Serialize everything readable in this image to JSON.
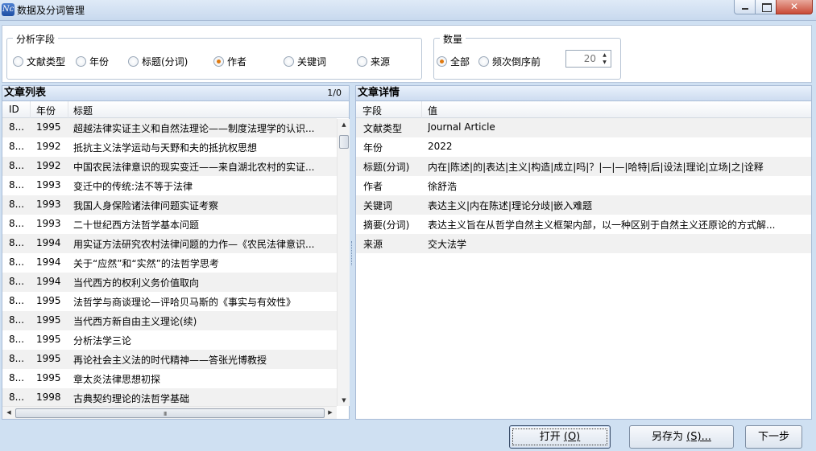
{
  "window": {
    "title": "数据及分词管理",
    "icon_text": "Nc",
    "close_glyph": "✕"
  },
  "field_group": {
    "legend": "分析字段",
    "options": [
      {
        "label": "文献类型",
        "checked": false
      },
      {
        "label": "年份",
        "checked": false
      },
      {
        "label": "标题(分词)",
        "checked": false
      },
      {
        "label": "作者",
        "checked": true
      },
      {
        "label": "关键词",
        "checked": false
      },
      {
        "label": "来源",
        "checked": false
      }
    ]
  },
  "count_group": {
    "legend": "数量",
    "options": [
      {
        "label": "全部",
        "checked": true
      },
      {
        "label": "频次倒序前",
        "checked": false
      }
    ],
    "spin_value": "20"
  },
  "doc_list": {
    "title": "文章列表",
    "count": "1/0",
    "columns": [
      "ID",
      "年份",
      "标题"
    ],
    "rows": [
      {
        "id": "8...",
        "year": "1995",
        "title": "超越法律实证主义和自然法理论——制度法理学的认识..."
      },
      {
        "id": "8...",
        "year": "1992",
        "title": "抵抗主义法学运动与天野和夫的抵抗权思想"
      },
      {
        "id": "8...",
        "year": "1992",
        "title": "中国农民法律意识的现实变迁——来自湖北农村的实证..."
      },
      {
        "id": "8...",
        "year": "1993",
        "title": "变迁中的传统:法不等于法律"
      },
      {
        "id": "8...",
        "year": "1993",
        "title": "我国人身保险诸法律问题实证考察"
      },
      {
        "id": "8...",
        "year": "1993",
        "title": "二十世纪西方法哲学基本问题"
      },
      {
        "id": "8...",
        "year": "1994",
        "title": "用实证方法研究农村法律问题的力作—《农民法律意识..."
      },
      {
        "id": "8...",
        "year": "1994",
        "title": "关于“应然”和“实然”的法哲学思考"
      },
      {
        "id": "8...",
        "year": "1994",
        "title": "当代西方的权利义务价值取向"
      },
      {
        "id": "8...",
        "year": "1995",
        "title": "法哲学与商谈理论—评哈贝马斯的《事实与有效性》"
      },
      {
        "id": "8...",
        "year": "1995",
        "title": "当代西方新自由主义理论(续)"
      },
      {
        "id": "8...",
        "year": "1995",
        "title": "分析法学三论"
      },
      {
        "id": "8...",
        "year": "1995",
        "title": "再论社会主义法的时代精神——答张光博教授"
      },
      {
        "id": "8...",
        "year": "1995",
        "title": "章太炎法律思想初探"
      },
      {
        "id": "8...",
        "year": "1998",
        "title": "古典契约理论的法哲学基础"
      }
    ],
    "scroll_up": "▲",
    "scroll_down": "▼",
    "scroll_left": "◀",
    "scroll_right": "▶",
    "grip": "III"
  },
  "detail": {
    "title": "文章详情",
    "columns": [
      "字段",
      "值"
    ],
    "rows": [
      {
        "field": "文献类型",
        "value": "Journal Article"
      },
      {
        "field": "年份",
        "value": "2022"
      },
      {
        "field": "标题(分词)",
        "value": "内在|陈述|的|表达|主义|构造|成立|吗|？|—|—|哈特|后|设法|理论|立场|之|诠释"
      },
      {
        "field": "作者",
        "value": "徐舒浩"
      },
      {
        "field": "关键词",
        "value": "表达主义|内在陈述|理论分歧|嵌入难题"
      },
      {
        "field": "摘要(分词)",
        "value": "表达主义旨在从哲学自然主义框架内部，以一种区别于自然主义还原论的方式解..."
      },
      {
        "field": "来源",
        "value": "交大法学"
      }
    ]
  },
  "buttons": {
    "open": {
      "label": "打开",
      "key": "(O)"
    },
    "save_as": {
      "label": "另存为",
      "key": "(S)..."
    },
    "next": {
      "label": "下一步"
    }
  }
}
